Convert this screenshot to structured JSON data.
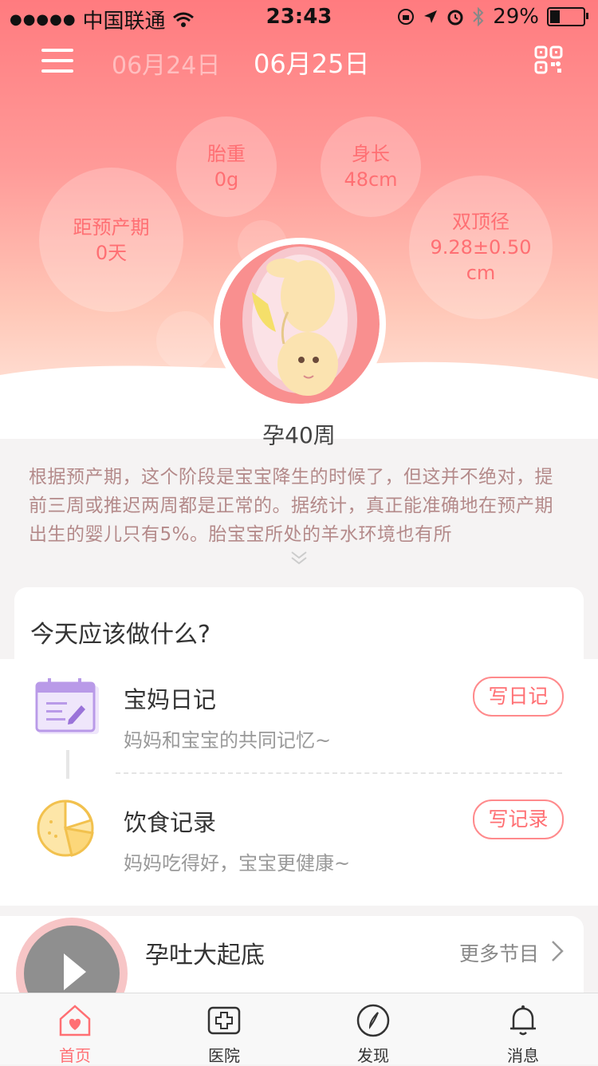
{
  "status_bar": {
    "carrier": "中国联通",
    "time": "23:43",
    "battery": "29%"
  },
  "nav": {
    "prev_date": "06月24日",
    "current_date": "06月25日"
  },
  "stats": {
    "due": {
      "label": "距预产期",
      "value": "0天"
    },
    "weight": {
      "label": "胎重",
      "value": "0g"
    },
    "length": {
      "label": "身长",
      "value": "48cm"
    },
    "bpd": {
      "label": "双顶径",
      "value": "9.28±0.50",
      "unit": "cm"
    }
  },
  "week": "孕40周",
  "description": "根据预产期，这个阶段是宝宝降生的时候了，但这并不绝对，提前三周或推迟两周都是正常的。据统计，真正能准确地在预产期出生的婴儿只有5%。胎宝宝所处的羊水环境也有所",
  "todo": {
    "title": "今天应该做什么?",
    "items": [
      {
        "title": "宝妈日记",
        "subtitle": "妈妈和宝宝的共同记忆~",
        "button": "写日记",
        "icon": "calendar-edit-icon"
      },
      {
        "title": "饮食记录",
        "subtitle": "妈妈吃得好，宝宝更健康~",
        "button": "写记录",
        "icon": "pie-chart-icon"
      }
    ]
  },
  "audio": {
    "title": "孕吐大起底",
    "more": "更多节目"
  },
  "tabs": [
    {
      "label": "首页",
      "icon": "home-heart-icon",
      "active": true
    },
    {
      "label": "医院",
      "icon": "hospital-cross-icon",
      "active": false
    },
    {
      "label": "发现",
      "icon": "compass-icon",
      "active": false
    },
    {
      "label": "消息",
      "icon": "bell-icon",
      "active": false
    }
  ],
  "colors": {
    "accent": "#ff6f73",
    "header_top": "#ff7b7f",
    "header_bottom": "#ffe6dc"
  }
}
